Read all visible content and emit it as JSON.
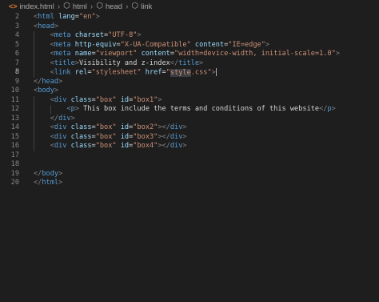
{
  "breadcrumb": {
    "file": "index.html",
    "items": [
      "html",
      "head",
      "link"
    ],
    "file_icon": "html-file-icon",
    "element_icon": "element-cube-icon",
    "separator": "›"
  },
  "editor": {
    "active_line": 8,
    "lines": [
      {
        "num": "2",
        "indent": 0,
        "tokens": [
          [
            "p",
            "<"
          ],
          [
            "t",
            "html"
          ],
          [
            "x",
            " "
          ],
          [
            "a",
            "lang"
          ],
          [
            "x",
            "="
          ],
          [
            "s",
            "\"en\""
          ],
          [
            "p",
            ">"
          ]
        ]
      },
      {
        "num": "3",
        "indent": 0,
        "tokens": [
          [
            "p",
            "<"
          ],
          [
            "t",
            "head"
          ],
          [
            "p",
            ">"
          ]
        ]
      },
      {
        "num": "4",
        "indent": 1,
        "tokens": [
          [
            "p",
            "<"
          ],
          [
            "t",
            "meta"
          ],
          [
            "x",
            " "
          ],
          [
            "a",
            "charset"
          ],
          [
            "x",
            "="
          ],
          [
            "s",
            "\"UTF-8\""
          ],
          [
            "p",
            ">"
          ]
        ]
      },
      {
        "num": "5",
        "indent": 1,
        "tokens": [
          [
            "p",
            "<"
          ],
          [
            "t",
            "meta"
          ],
          [
            "x",
            " "
          ],
          [
            "a",
            "http-equiv"
          ],
          [
            "x",
            "="
          ],
          [
            "s",
            "\"X-UA-Compatible\""
          ],
          [
            "x",
            " "
          ],
          [
            "a",
            "content"
          ],
          [
            "x",
            "="
          ],
          [
            "s",
            "\"IE=edge\""
          ],
          [
            "p",
            ">"
          ]
        ]
      },
      {
        "num": "6",
        "indent": 1,
        "tokens": [
          [
            "p",
            "<"
          ],
          [
            "t",
            "meta"
          ],
          [
            "x",
            " "
          ],
          [
            "a",
            "name"
          ],
          [
            "x",
            "="
          ],
          [
            "s",
            "\"viewport\""
          ],
          [
            "x",
            " "
          ],
          [
            "a",
            "content"
          ],
          [
            "x",
            "="
          ],
          [
            "s",
            "\"width=device-width, initial-scale=1.0\""
          ],
          [
            "p",
            ">"
          ]
        ]
      },
      {
        "num": "7",
        "indent": 1,
        "tokens": [
          [
            "p",
            "<"
          ],
          [
            "t",
            "title"
          ],
          [
            "p",
            ">"
          ],
          [
            "x",
            "Visibility and z-index"
          ],
          [
            "p",
            "</"
          ],
          [
            "t",
            "title"
          ],
          [
            "p",
            ">"
          ]
        ]
      },
      {
        "num": "8",
        "indent": 1,
        "tokens": [
          [
            "p",
            "<"
          ],
          [
            "t",
            "link"
          ],
          [
            "x",
            " "
          ],
          [
            "a",
            "rel"
          ],
          [
            "x",
            "="
          ],
          [
            "s",
            "\"stylesheet\""
          ],
          [
            "x",
            " "
          ],
          [
            "a",
            "href"
          ],
          [
            "x",
            "="
          ],
          [
            "s",
            "\""
          ],
          [
            "sh",
            "style"
          ],
          [
            "s",
            ".css\""
          ],
          [
            "p",
            ">"
          ]
        ],
        "cursor": true
      },
      {
        "num": "9",
        "indent": 0,
        "tokens": [
          [
            "p",
            "</"
          ],
          [
            "t",
            "head"
          ],
          [
            "p",
            ">"
          ]
        ]
      },
      {
        "num": "10",
        "indent": 0,
        "tokens": [
          [
            "p",
            "<"
          ],
          [
            "t",
            "body"
          ],
          [
            "p",
            ">"
          ]
        ]
      },
      {
        "num": "11",
        "indent": 1,
        "tokens": [
          [
            "p",
            "<"
          ],
          [
            "t",
            "div"
          ],
          [
            "x",
            " "
          ],
          [
            "a",
            "class"
          ],
          [
            "x",
            "="
          ],
          [
            "s",
            "\"box\""
          ],
          [
            "x",
            " "
          ],
          [
            "a",
            "id"
          ],
          [
            "x",
            "="
          ],
          [
            "s",
            "\"box1\""
          ],
          [
            "p",
            ">"
          ]
        ]
      },
      {
        "num": "12",
        "indent": 2,
        "tokens": [
          [
            "p",
            "<"
          ],
          [
            "t",
            "p"
          ],
          [
            "p",
            ">"
          ],
          [
            "x",
            " This box include the terms and conditions of this website"
          ],
          [
            "p",
            "</"
          ],
          [
            "t",
            "p"
          ],
          [
            "p",
            ">"
          ]
        ]
      },
      {
        "num": "13",
        "indent": 1,
        "tokens": [
          [
            "p",
            "</"
          ],
          [
            "t",
            "div"
          ],
          [
            "p",
            ">"
          ]
        ]
      },
      {
        "num": "14",
        "indent": 1,
        "tokens": [
          [
            "p",
            "<"
          ],
          [
            "t",
            "div"
          ],
          [
            "x",
            " "
          ],
          [
            "a",
            "class"
          ],
          [
            "x",
            "="
          ],
          [
            "s",
            "\"box\""
          ],
          [
            "x",
            " "
          ],
          [
            "a",
            "id"
          ],
          [
            "x",
            "="
          ],
          [
            "s",
            "\"box2\""
          ],
          [
            "p",
            "></"
          ],
          [
            "t",
            "div"
          ],
          [
            "p",
            ">"
          ]
        ]
      },
      {
        "num": "15",
        "indent": 1,
        "tokens": [
          [
            "p",
            "<"
          ],
          [
            "t",
            "div"
          ],
          [
            "x",
            " "
          ],
          [
            "a",
            "class"
          ],
          [
            "x",
            "="
          ],
          [
            "s",
            "\"box\""
          ],
          [
            "x",
            " "
          ],
          [
            "a",
            "id"
          ],
          [
            "x",
            "="
          ],
          [
            "s",
            "\"box3\""
          ],
          [
            "p",
            "></"
          ],
          [
            "t",
            "div"
          ],
          [
            "p",
            ">"
          ]
        ]
      },
      {
        "num": "16",
        "indent": 1,
        "tokens": [
          [
            "p",
            "<"
          ],
          [
            "t",
            "div"
          ],
          [
            "x",
            " "
          ],
          [
            "a",
            "class"
          ],
          [
            "x",
            "="
          ],
          [
            "s",
            "\"box\""
          ],
          [
            "x",
            " "
          ],
          [
            "a",
            "id"
          ],
          [
            "x",
            "="
          ],
          [
            "s",
            "\"box4\""
          ],
          [
            "p",
            "></"
          ],
          [
            "t",
            "div"
          ],
          [
            "p",
            ">"
          ]
        ]
      },
      {
        "num": "17",
        "indent": 0,
        "tokens": []
      },
      {
        "num": "18",
        "indent": 0,
        "tokens": []
      },
      {
        "num": "19",
        "indent": 0,
        "tokens": [
          [
            "p",
            "</"
          ],
          [
            "t",
            "body"
          ],
          [
            "p",
            ">"
          ]
        ]
      },
      {
        "num": "20",
        "indent": 0,
        "tokens": [
          [
            "p",
            "</"
          ],
          [
            "t",
            "html"
          ],
          [
            "p",
            ">"
          ]
        ]
      }
    ]
  }
}
